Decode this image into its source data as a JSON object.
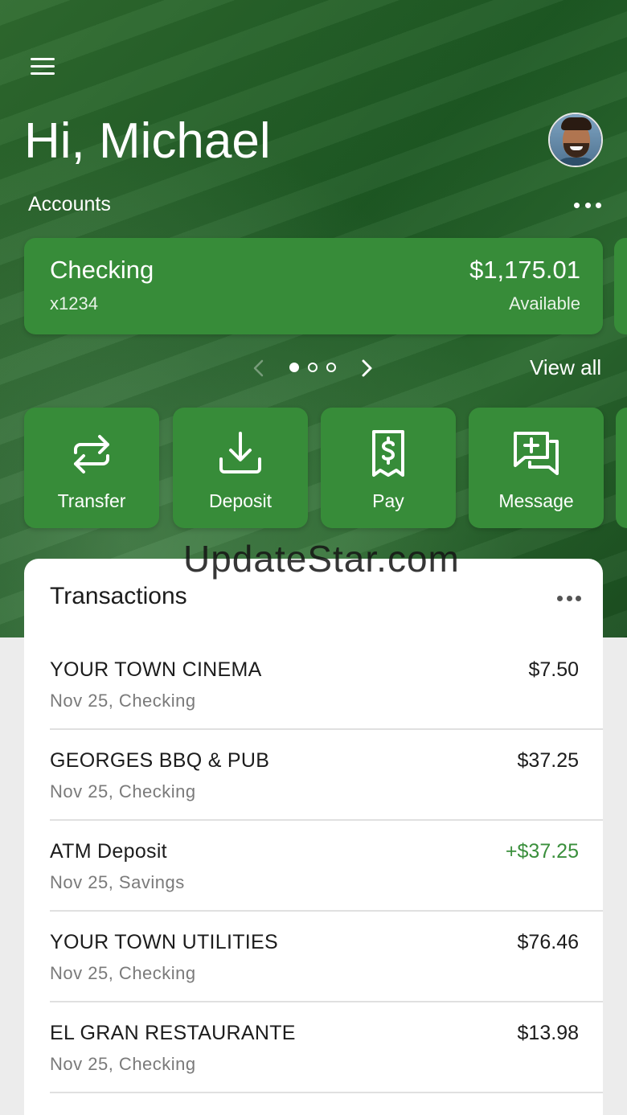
{
  "header": {
    "greeting": "Hi, Michael",
    "accounts_label": "Accounts"
  },
  "account_card": {
    "name": "Checking",
    "number": "x1234",
    "balance": "$1,175.01",
    "balance_label": "Available"
  },
  "pager": {
    "total_pages": 3,
    "active_page": 1,
    "view_all_label": "View all"
  },
  "actions": [
    {
      "label": "Transfer",
      "icon": "transfer-icon"
    },
    {
      "label": "Deposit",
      "icon": "deposit-icon"
    },
    {
      "label": "Pay",
      "icon": "pay-bill-icon"
    },
    {
      "label": "Message",
      "icon": "message-icon"
    }
  ],
  "watermark": "UpdateStar.com",
  "transactions": {
    "title": "Transactions",
    "items": [
      {
        "name": "YOUR TOWN CINEMA",
        "detail": "Nov 25, Checking",
        "amount": "$7.50",
        "credit": false
      },
      {
        "name": "GEORGES BBQ & PUB",
        "detail": "Nov 25, Checking",
        "amount": "$37.25",
        "credit": false
      },
      {
        "name": "ATM Deposit",
        "detail": "Nov 25, Savings",
        "amount": "+$37.25",
        "credit": true
      },
      {
        "name": "YOUR TOWN UTILITIES",
        "detail": "Nov 25, Checking",
        "amount": "$76.46",
        "credit": false
      },
      {
        "name": "EL GRAN RESTAURANTE",
        "detail": "Nov 25, Checking",
        "amount": "$13.98",
        "credit": false
      }
    ]
  },
  "colors": {
    "brand_green": "#378c39",
    "credit_green": "#3a8f3c",
    "hero_dark": "#1e5a24"
  }
}
